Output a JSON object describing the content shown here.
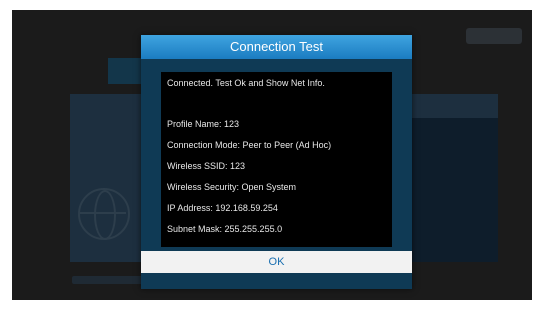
{
  "dialog": {
    "title": "Connection Test",
    "status_line": "Connected. Test Ok and Show Net Info.",
    "info": [
      "Profile Name: 123",
      "Connection Mode: Peer to Peer (Ad Hoc)",
      "Wireless SSID: 123",
      "Wireless Security: Open System",
      "IP Address: 192.168.59.254",
      "Subnet Mask: 255.255.255.0"
    ],
    "ok_label": "OK"
  },
  "colors": {
    "title_bar": "#2a8fd3",
    "dialog_frame": "#0f3a55",
    "info_background": "#000000",
    "ok_text": "#1a6fb0"
  }
}
